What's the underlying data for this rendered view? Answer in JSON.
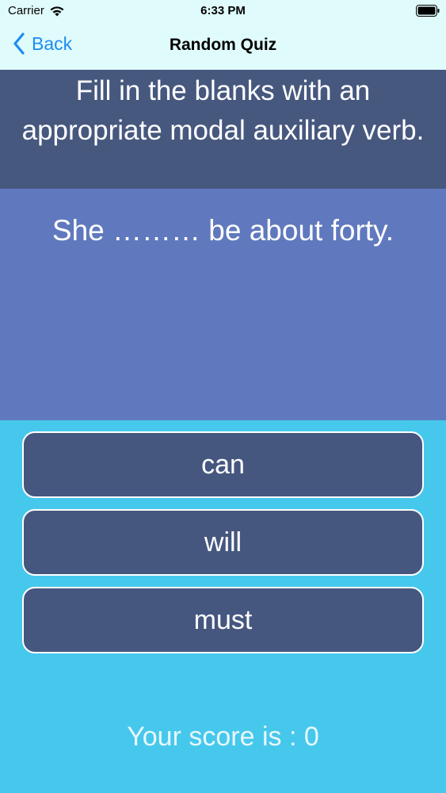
{
  "status_bar": {
    "carrier": "Carrier",
    "time": "6:33 PM",
    "wifi_icon": "wifi-icon",
    "battery_icon": "battery-icon"
  },
  "nav": {
    "back_label": "Back",
    "title": "Random Quiz",
    "accent_color": "#1e8cf0"
  },
  "quiz": {
    "instruction": "Fill in the blanks with an appropriate modal auxiliary verb.",
    "question": "She ……… be about forty.",
    "answers": [
      {
        "label": "can"
      },
      {
        "label": "will"
      },
      {
        "label": "must"
      }
    ],
    "score_text": "Your score is : 0"
  },
  "colors": {
    "instruction_bg": "#47587f",
    "question_bg": "#6079be",
    "page_bg": "#46c8ec",
    "button_bg": "#45577f",
    "nav_bg": "#e0fbfc"
  }
}
